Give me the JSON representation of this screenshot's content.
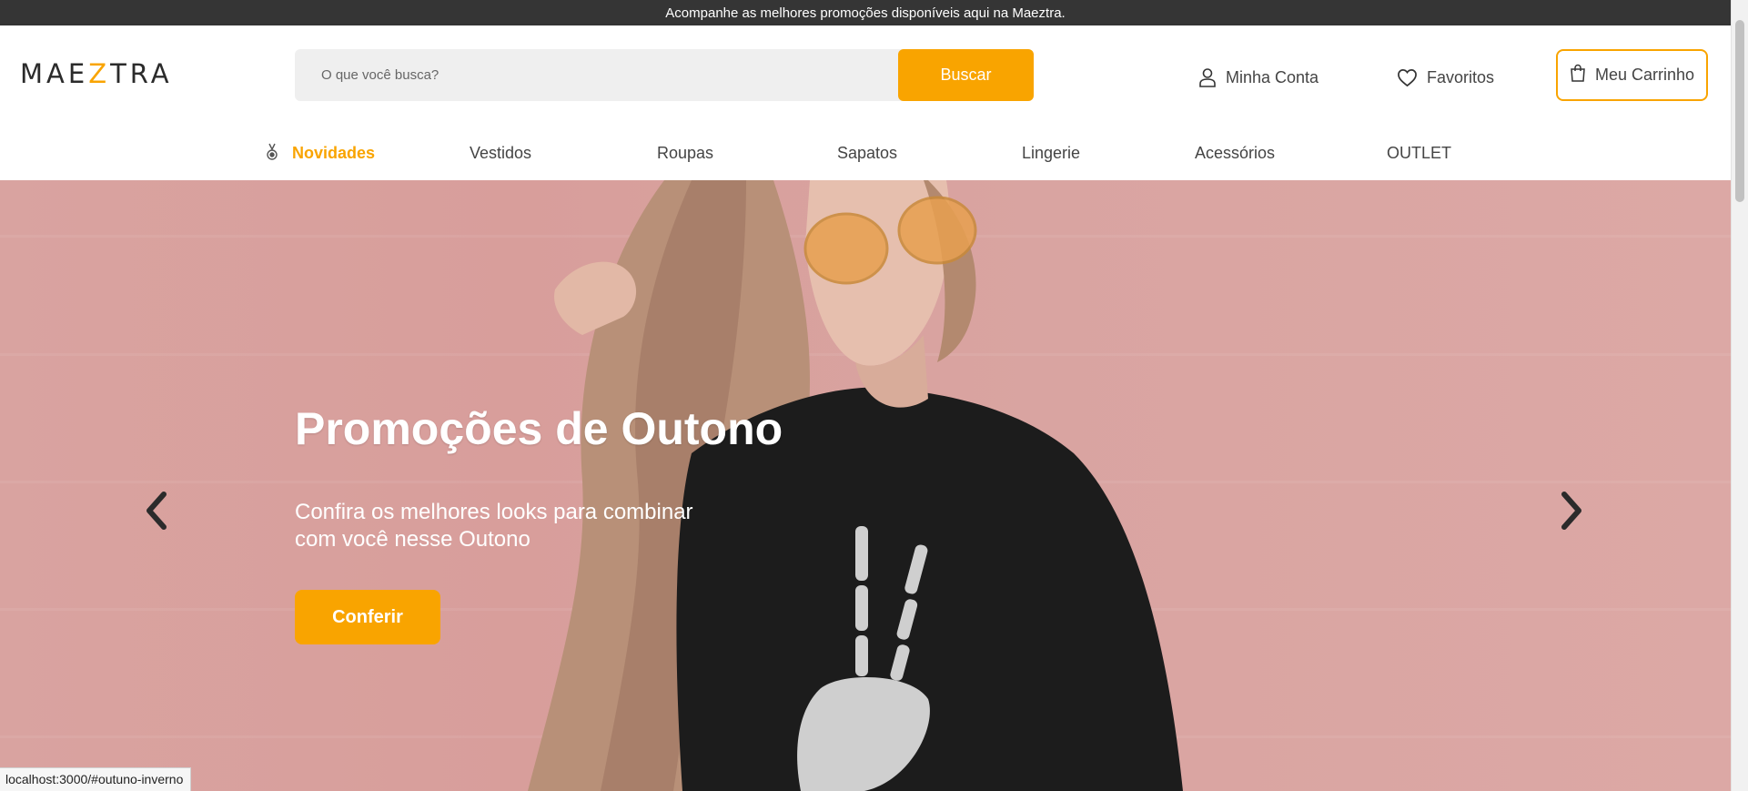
{
  "colors": {
    "accent": "#f9a400",
    "topbar_bg": "#353535",
    "hero_bg": "#d9a3a0"
  },
  "topbar": {
    "text": "Acompanhe as melhores promoções disponíveis aqui na Maeztra."
  },
  "header": {
    "logo": {
      "part1": "MAE",
      "z": "Z",
      "part2": "TRA"
    },
    "search": {
      "placeholder": "O que você busca?",
      "value": "",
      "button_label": "Buscar"
    },
    "account": {
      "label": "Minha Conta",
      "icon": "user-icon"
    },
    "favorites": {
      "label": "Favoritos",
      "icon": "heart-icon"
    },
    "cart": {
      "label": "Meu Carrinho",
      "icon": "shopping-bag-icon"
    }
  },
  "nav": {
    "items": [
      {
        "label": "Novidades",
        "active": true,
        "icon": "medal-icon"
      },
      {
        "label": "Vestidos"
      },
      {
        "label": "Roupas"
      },
      {
        "label": "Sapatos"
      },
      {
        "label": "Lingerie"
      },
      {
        "label": "Acessórios"
      },
      {
        "label": "OUTLET"
      }
    ]
  },
  "hero": {
    "title": "Promoções de Outono",
    "subtitle": "Confira os melhores looks para combinar com você nesse Outono",
    "button_label": "Conferir",
    "prev_icon": "chevron-left-icon",
    "next_icon": "chevron-right-icon"
  },
  "statusbar": {
    "url": "localhost:3000/#outuno-inverno"
  }
}
